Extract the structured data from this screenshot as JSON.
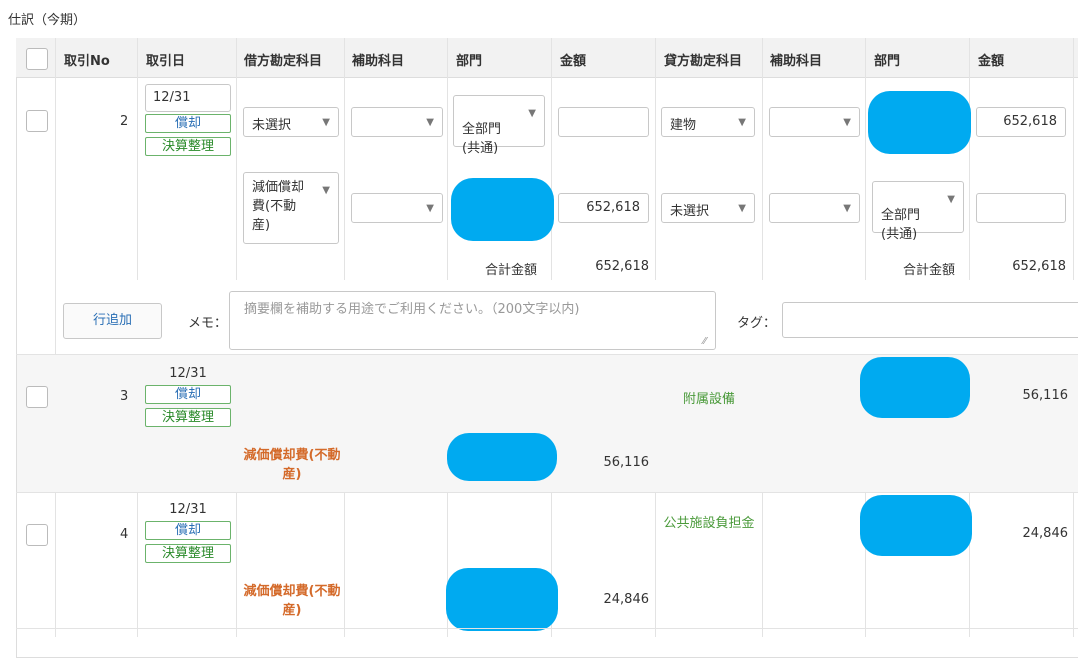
{
  "section_title": "仕訳（今期）",
  "headers": {
    "no": "取引No",
    "date": "取引日",
    "debit_account": "借方勘定科目",
    "debit_sub": "補助科目",
    "debit_dept": "部門",
    "debit_amount": "金額",
    "credit_account": "貸方勘定科目",
    "credit_sub": "補助科目",
    "credit_dept": "部門",
    "credit_amount": "金額"
  },
  "entry2": {
    "no": "2",
    "date": "12/31",
    "tag1": "償却",
    "tag2": "決算整理",
    "line1": {
      "debit_account": "未選択",
      "debit_dept": "全部門\n(共通)",
      "credit_account": "建物",
      "credit_amount": "652,618"
    },
    "line2": {
      "debit_account": "減価償却費(不動産)",
      "debit_amount": "652,618",
      "credit_account": "未選択",
      "credit_dept": "全部門\n(共通)"
    },
    "total_label_debit": "合計金額",
    "total_debit": "652,618",
    "total_label_credit": "合計金額",
    "total_credit": "652,618"
  },
  "row_add_button": "行追加",
  "memo_label": "メモ：",
  "memo_placeholder": "摘要欄を補助する用途でご利用ください。（200文字以内)",
  "tag_label": "タグ：",
  "entry3": {
    "no": "3",
    "date": "12/31",
    "tag1": "償却",
    "tag2": "決算整理",
    "credit_account": "附属設備",
    "credit_amount": "56,116",
    "debit_account": "減価償却費(不動産)",
    "debit_amount": "56,116"
  },
  "entry4": {
    "no": "4",
    "date": "12/31",
    "tag1": "償却",
    "tag2": "決算整理",
    "credit_account": "公共施設負担金",
    "credit_amount": "24,846",
    "debit_account": "減価償却費(不動産)",
    "debit_amount": "24,846"
  },
  "colors": {
    "redaction": "#00aaf0",
    "tag_border": "#6bb36b",
    "debit_account": "#d46a2a",
    "credit_account": "#4a9a3a"
  }
}
